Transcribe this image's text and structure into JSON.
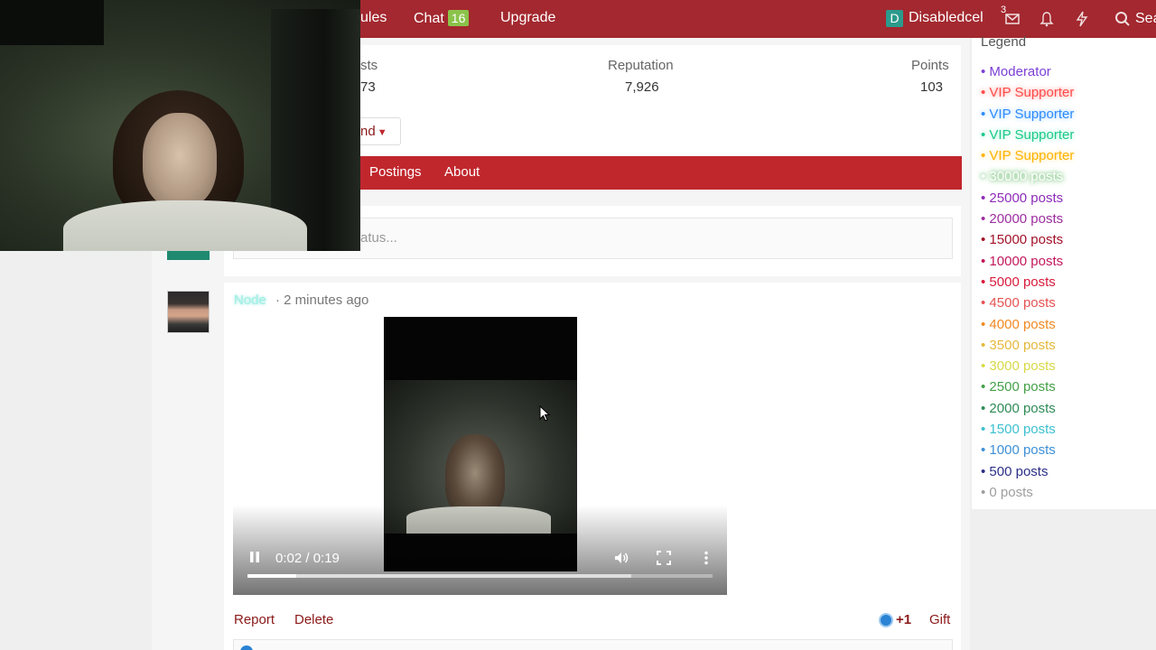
{
  "nav": {
    "rules_partial": "ules",
    "chat_label": "Chat",
    "chat_count": "16",
    "upgrade_label": "Upgrade",
    "user_initial": "D",
    "username": "Disabledcel",
    "messages_count": "3",
    "search_partial": "Sea"
  },
  "profile": {
    "stats": [
      {
        "label": "sts",
        "value": "73"
      },
      {
        "label": "Reputation",
        "value": "7,926"
      },
      {
        "label": "Points",
        "value": "103"
      }
    ],
    "friend_button_partial": "nd",
    "tabs": [
      "Postings",
      "About"
    ],
    "status_placeholder_partial": "atus..."
  },
  "post": {
    "author": "Node",
    "time": "· 2 minutes ago",
    "video": {
      "current_time": "0:02",
      "duration": "0:19",
      "time_display": "0:02 / 0:19",
      "played_fraction": 0.105,
      "buffered_fraction": 0.825
    },
    "actions": {
      "report": "Report",
      "delete": "Delete",
      "like_count": "+1",
      "gift": "Gift"
    }
  },
  "legend": {
    "title": "Legend",
    "items": [
      {
        "label": "• Moderator",
        "color": "#7b3fd6",
        "glow": ""
      },
      {
        "label": "• VIP Supporter",
        "color": "#ff4b4b",
        "glow": "glow-red"
      },
      {
        "label": "• VIP Supporter",
        "color": "#2c8bff",
        "glow": "glow-blue"
      },
      {
        "label": "• VIP Supporter",
        "color": "#1ec98e",
        "glow": "glow-green"
      },
      {
        "label": "• VIP Supporter",
        "color": "#ffb300",
        "glow": "glow-orange"
      },
      {
        "label": "• 30000 posts",
        "color": "#ffffff",
        "glow": "glow-white"
      },
      {
        "label": "• 25000 posts",
        "color": "#8e2bb8",
        "glow": ""
      },
      {
        "label": "• 20000 posts",
        "color": "#9c2d9f",
        "glow": ""
      },
      {
        "label": "• 15000 posts",
        "color": "#a3122a",
        "glow": ""
      },
      {
        "label": "• 10000 posts",
        "color": "#c2185b",
        "glow": ""
      },
      {
        "label": "• 5000 posts",
        "color": "#d81b3c",
        "glow": ""
      },
      {
        "label": "• 4500 posts",
        "color": "#e55353",
        "glow": ""
      },
      {
        "label": "• 4000 posts",
        "color": "#f08a24",
        "glow": ""
      },
      {
        "label": "• 3500 posts",
        "color": "#e5b83a",
        "glow": ""
      },
      {
        "label": "• 3000 posts",
        "color": "#d8d94a",
        "glow": ""
      },
      {
        "label": "• 2500 posts",
        "color": "#43a047",
        "glow": ""
      },
      {
        "label": "• 2000 posts",
        "color": "#2e8b57",
        "glow": ""
      },
      {
        "label": "• 1500 posts",
        "color": "#3cc0cf",
        "glow": ""
      },
      {
        "label": "• 1000 posts",
        "color": "#3d8fd6",
        "glow": ""
      },
      {
        "label": "• 500 posts",
        "color": "#2b2f86",
        "glow": ""
      },
      {
        "label": "• 0 posts",
        "color": "#9e9e9e",
        "glow": ""
      }
    ]
  },
  "colors": {
    "brand_red": "#a3282f",
    "tab_red": "#c0272d",
    "link_red": "#8b1a1a",
    "chat_badge_green": "#8bc34a"
  },
  "icons": [
    "messages-icon",
    "bell-icon",
    "bolt-icon",
    "search-icon",
    "pause-icon",
    "volume-icon",
    "fullscreen-icon",
    "more-vertical-icon",
    "caret-down-icon",
    "like-icon"
  ]
}
